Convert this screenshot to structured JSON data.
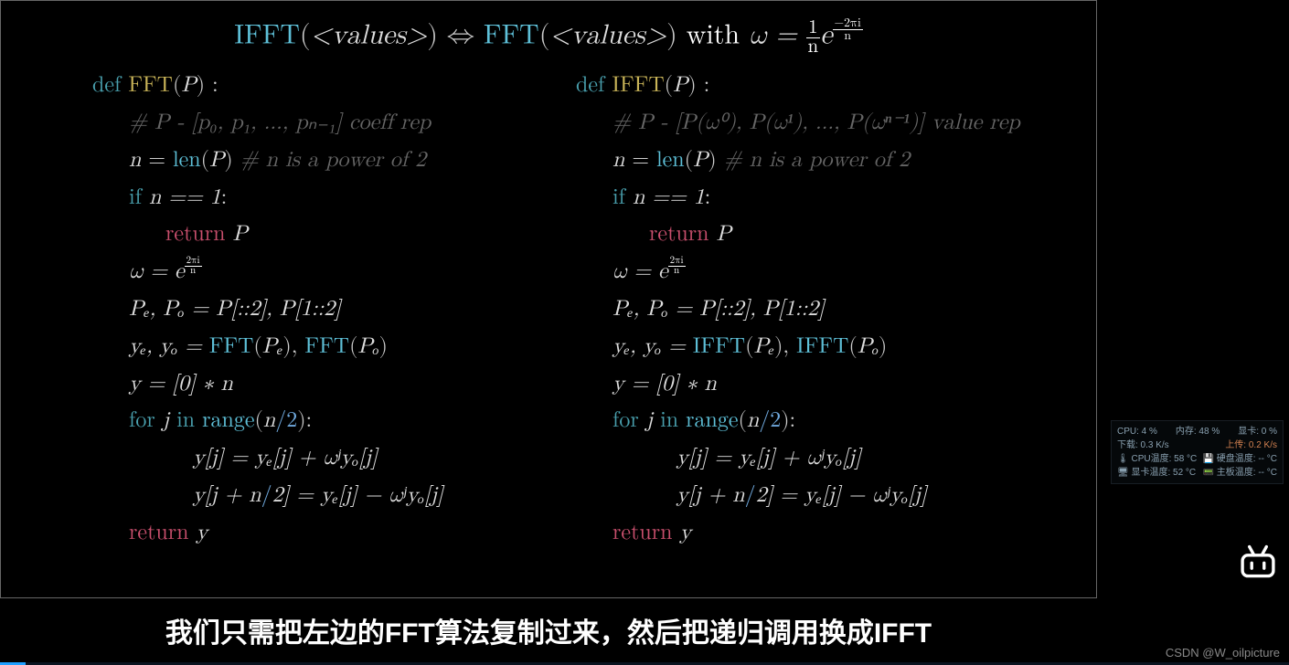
{
  "header": {
    "ifft_label": "IFFT",
    "fft_label": "FFT",
    "values_text": "<values>",
    "arrow": "⇔",
    "with_text": "with",
    "omega_eq": "ω =",
    "frac_top": "1",
    "frac_bot": "n",
    "e_text": "e",
    "exp_top": "−2πi",
    "exp_bot": "n"
  },
  "left": {
    "def_kw": "def",
    "fn_name": "FFT",
    "arg": "P",
    "comment_rep": "# P - [p₀, p₁, …, pₙ₋₁] coeff rep",
    "len_line_a": "n",
    "len_fn": "len",
    "len_line_b": "P",
    "comment_pow2": "# n is a power of 2",
    "if_kw": "if",
    "eq_test": "n == 1",
    "ret_kw": "return",
    "ret_P": "P",
    "omega_line_lhs": "ω = e",
    "omega_exp_top": "2πi",
    "omega_exp_bot": "n",
    "split_line": "Pₑ, Pₒ = P[::2], P[1::2]",
    "rec_lhs": "yₑ, yₒ =",
    "rec_call": "FFT",
    "rec_a": "Pₑ",
    "rec_b": "Pₒ",
    "yinit": "y = [0] ∗ n",
    "for_kw": "for",
    "j_var": "j",
    "in_kw": "in",
    "range_fn": "range",
    "range_arg_a": "n",
    "range_arg_b": "2",
    "body1": "y[j] = yₑ[j] + ωʲyₒ[j]",
    "body2_a": "y[j + n",
    "body2_b": "2] = yₑ[j] − ωʲyₒ[j]",
    "ret2": "return",
    "ret_y": "y"
  },
  "right": {
    "def_kw": "def",
    "fn_name": "IFFT",
    "arg": "P",
    "comment_rep": "# P - [P(ω⁰), P(ω¹), …, P(ωⁿ⁻¹)] value rep",
    "len_line_a": "n",
    "len_fn": "len",
    "len_line_b": "P",
    "comment_pow2": "# n is a power of 2",
    "if_kw": "if",
    "eq_test": "n == 1",
    "ret_kw": "return",
    "ret_P": "P",
    "omega_line_lhs": "ω = e",
    "omega_exp_top": "2πi",
    "omega_exp_bot": "n",
    "split_line": "Pₑ, Pₒ = P[::2], P[1::2]",
    "rec_lhs": "yₑ, yₒ =",
    "rec_call": "IFFT",
    "rec_a": "Pₑ",
    "rec_b": "Pₒ",
    "yinit": "y = [0] ∗ n",
    "for_kw": "for",
    "j_var": "j",
    "in_kw": "in",
    "range_fn": "range",
    "range_arg_a": "n",
    "range_arg_b": "2",
    "body1": "y[j] = yₑ[j] + ωʲyₒ[j]",
    "body2_a": "y[j + n",
    "body2_b": "2] = yₑ[j] − ωʲyₒ[j]",
    "ret2": "return",
    "ret_y": "y"
  },
  "caption": "我们只需把左边的FFT算法复制过来，然后把递归调用换成IFFT",
  "watermark": "CSDN @W_oilpicture",
  "overlay": {
    "r1a": "CPU: 4 %",
    "r1b": "内存: 48 %",
    "r1c": "显卡: 0 %",
    "r2a": "下载: 0.3 K/s",
    "r2b": "上传: 0.2 K/s",
    "r3a": "🌡 CPU温度: 58 °C",
    "r3b": "💾 硬盘温度: -- °C",
    "r4a": "🖥 显卡温度: 52 °C",
    "r4b": "📟 主板温度: -- °C"
  }
}
